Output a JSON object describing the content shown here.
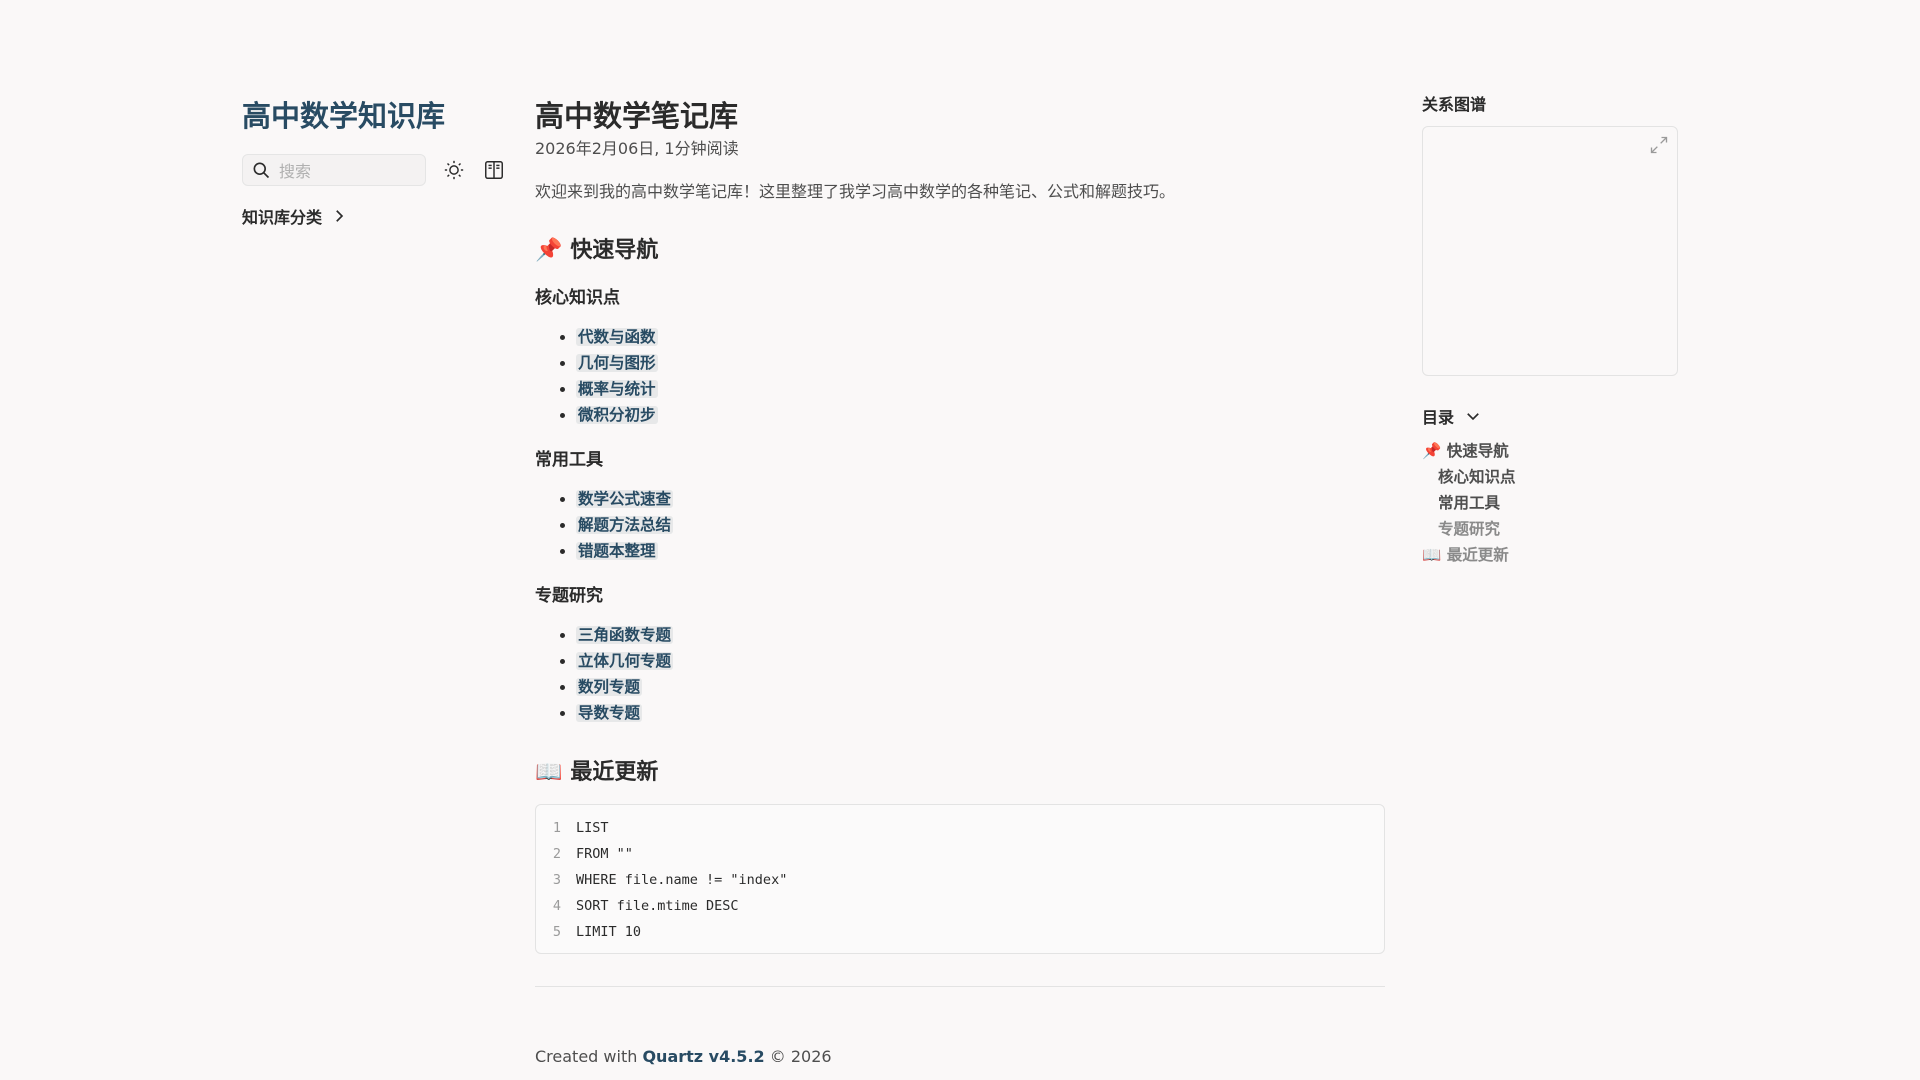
{
  "sidebar": {
    "site_title": "高中数学知识库",
    "search_placeholder": "搜索",
    "explorer_label": "知识库分类"
  },
  "article": {
    "title": "高中数学笔记库",
    "meta": "2026年2月06日, 1分钟阅读",
    "intro": "欢迎来到我的高中数学笔记库！这里整理了我学习高中数学的各种笔记、公式和解题技巧。",
    "nav_heading": {
      "emoji": "📌",
      "text": "快速导航"
    },
    "sections": [
      {
        "heading": "核心知识点",
        "links": [
          "代数与函数",
          "几何与图形",
          "概率与统计",
          "微积分初步"
        ]
      },
      {
        "heading": "常用工具",
        "links": [
          "数学公式速查",
          "解题方法总结",
          "错题本整理"
        ]
      },
      {
        "heading": "专题研究",
        "links": [
          "三角函数专题",
          "立体几何专题",
          "数列专题",
          "导数专题"
        ]
      }
    ],
    "recent_heading": {
      "emoji": "📖",
      "text": "最近更新"
    },
    "code_lines": [
      {
        "n": "1",
        "text": "LIST"
      },
      {
        "n": "2",
        "text": "FROM \"\""
      },
      {
        "n": "3",
        "text": "WHERE file.name != \"index\""
      },
      {
        "n": "4",
        "text": "SORT file.mtime DESC"
      },
      {
        "n": "5",
        "text": "LIMIT 10"
      }
    ]
  },
  "footer": {
    "prefix": "Created with",
    "link": "Quartz v4.5.2",
    "suffix": "© 2026"
  },
  "right": {
    "graph_title": "关系图谱",
    "toc_title": "目录",
    "toc_items": [
      {
        "text": "📌 快速导航",
        "level": 1
      },
      {
        "text": "核心知识点",
        "level": 2
      },
      {
        "text": "常用工具",
        "level": 2
      },
      {
        "text": "专题研究",
        "level": 2,
        "dim": true
      },
      {
        "text": "📖 最近更新",
        "level": 1,
        "dim": true
      }
    ]
  },
  "colors": {
    "accent": "#284b63",
    "text": "#2b2b2b",
    "muted": "#4e4e4e",
    "background": "#faf8f8"
  },
  "icons": {
    "search": "search-icon",
    "theme": "sun-icon",
    "reader": "book-icon",
    "expand": "expand-icon",
    "chevron_right": "chevron-right-icon",
    "chevron_down": "chevron-down-icon"
  }
}
